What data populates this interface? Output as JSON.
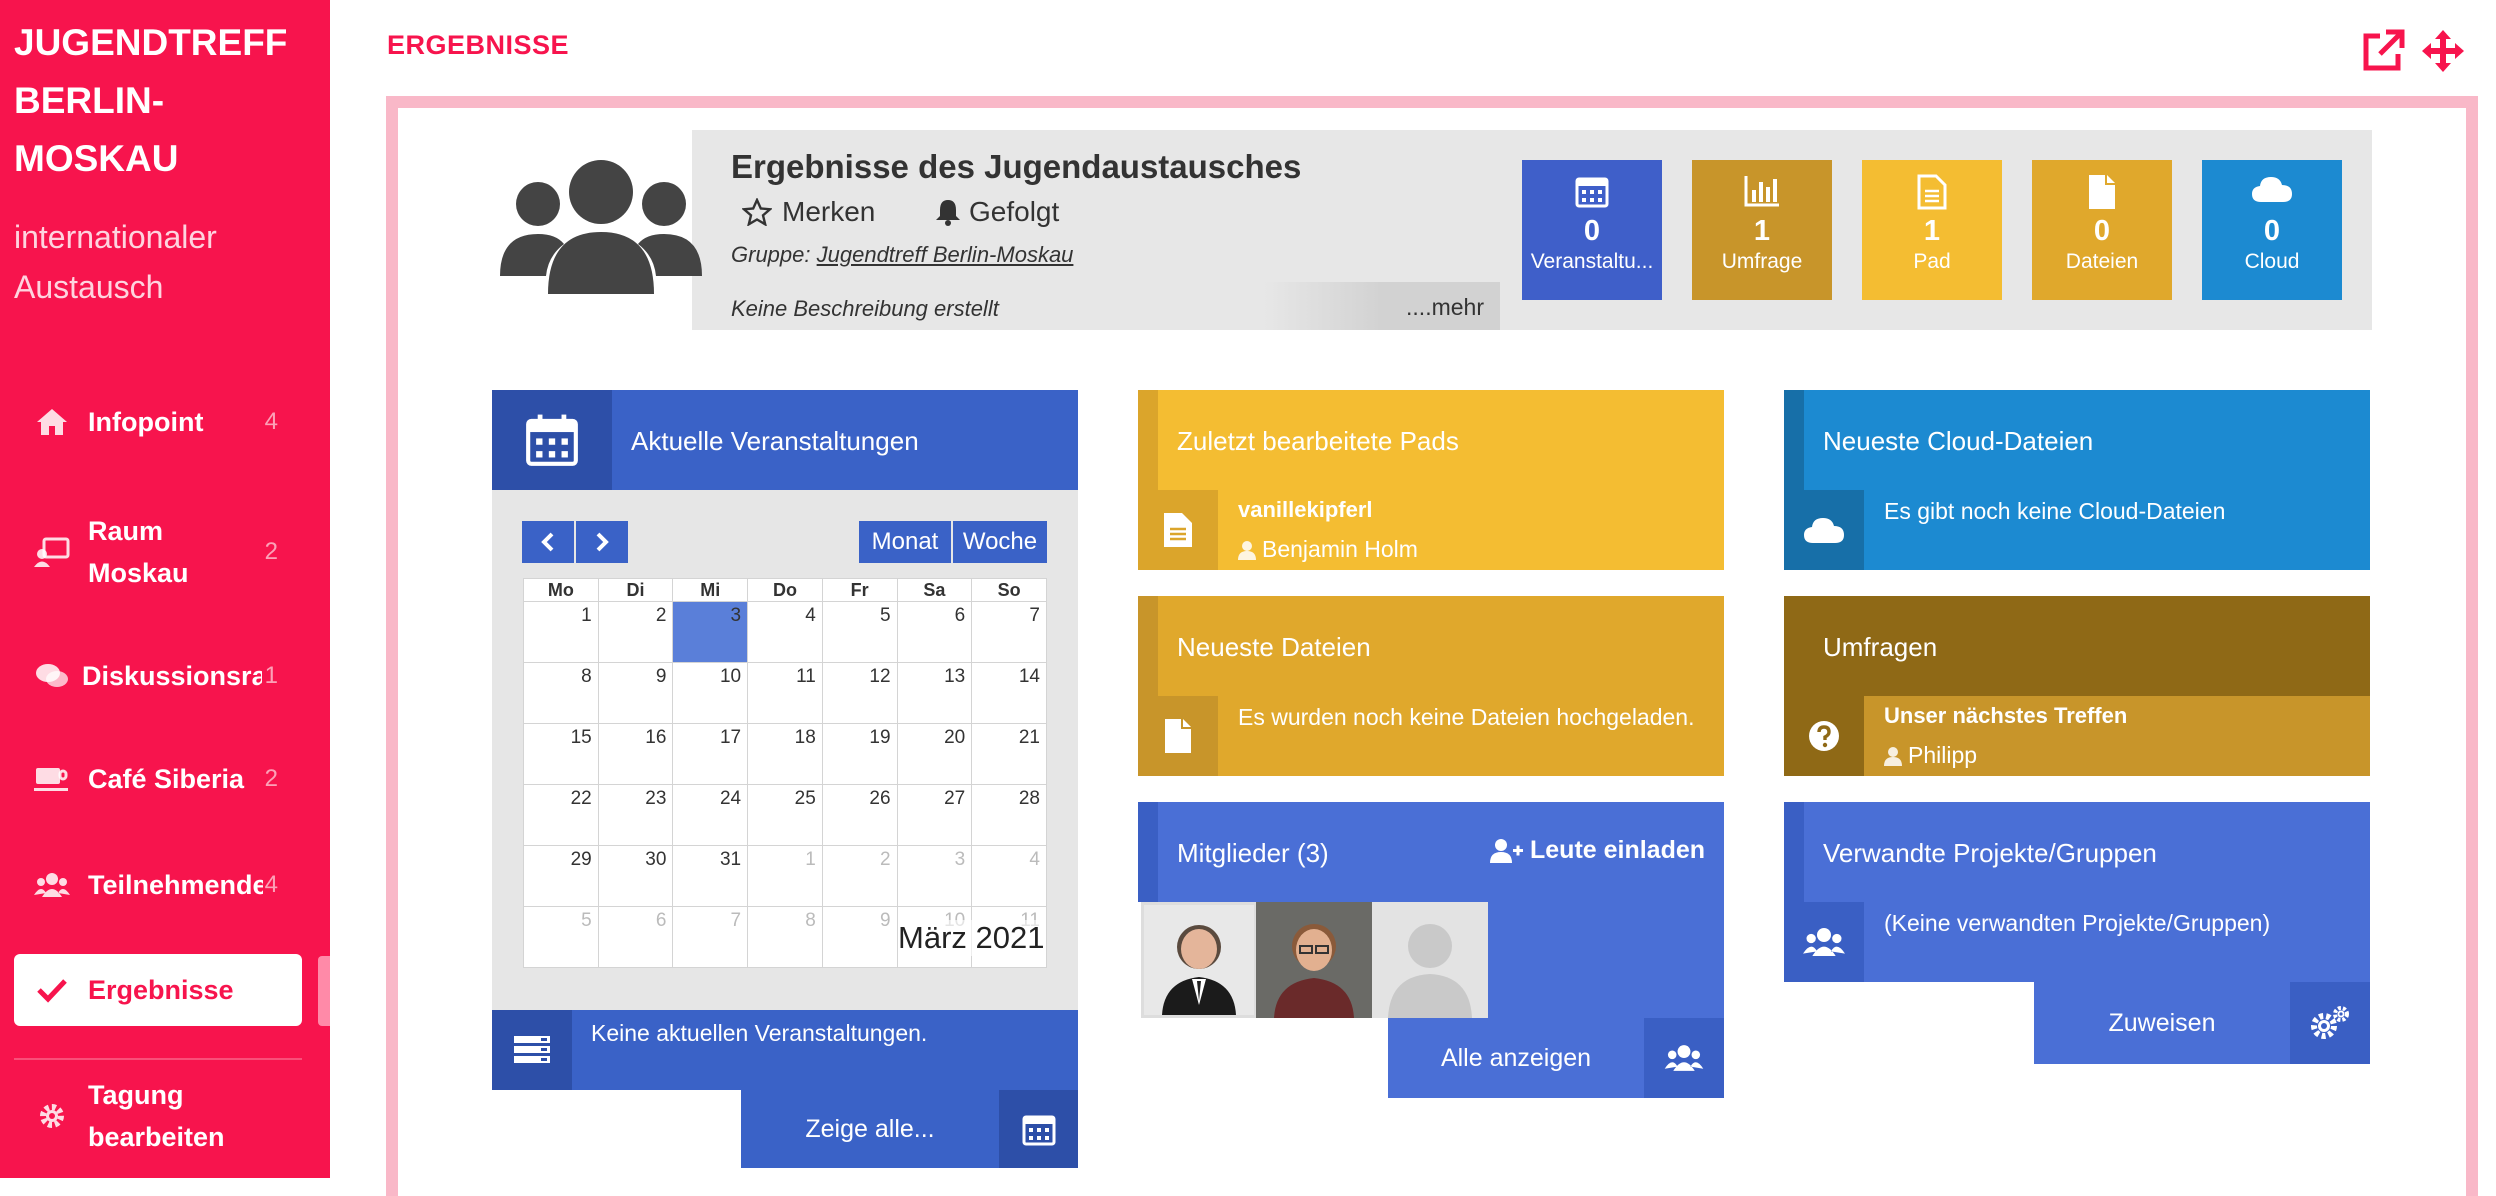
{
  "sidebar": {
    "brand_lines": [
      "JUGENDTREFF",
      "BERLIN-",
      "MOSKAU"
    ],
    "subtitle_lines": [
      "internationaler",
      "Austausch"
    ],
    "items": [
      {
        "label": "Infopoint",
        "count": "4",
        "icon": "home-icon"
      },
      {
        "label_lines": [
          "Raum",
          "Moskau"
        ],
        "count": "2",
        "icon": "room-icon"
      },
      {
        "label": "Diskussionsraum",
        "count": "1",
        "icon": "comments-icon"
      },
      {
        "label": "Café Siberia",
        "count": "2",
        "icon": "coffee-icon"
      },
      {
        "label": "Teilnehmende",
        "count": "4",
        "icon": "users-icon"
      },
      {
        "label": "Ergebnisse",
        "count": "",
        "icon": "check-icon",
        "active": true
      },
      {
        "label_lines": [
          "Tagung",
          "bearbeiten"
        ],
        "count": "",
        "icon": "gear-icon"
      }
    ]
  },
  "page": {
    "title": "ERGEBNISSE"
  },
  "header": {
    "title": "Ergebnisse des Jugendaustausches",
    "merken": "Merken",
    "gefolgt": "Gefolgt",
    "gruppe_label": "Gruppe:",
    "gruppe_link": "Jugendtreff Berlin-Moskau",
    "description": "Keine Beschreibung erstellt",
    "mehr": "....mehr"
  },
  "stats": [
    {
      "value": "0",
      "label": "Veranstaltu...",
      "color": "#3f5fc9",
      "icon": "calendar-icon"
    },
    {
      "value": "1",
      "label": "Umfrage",
      "color": "#c8952a",
      "icon": "poll-icon"
    },
    {
      "value": "1",
      "label": "Pad",
      "color": "#f4bd32",
      "icon": "pad-icon"
    },
    {
      "value": "0",
      "label": "Dateien",
      "color": "#e0a82c",
      "icon": "file-icon"
    },
    {
      "value": "0",
      "label": "Cloud",
      "color": "#1c8ad1",
      "icon": "cloud-icon"
    }
  ],
  "events": {
    "title": "Aktuelle Veranstaltungen",
    "view_month": "Monat",
    "view_week": "Woche",
    "weekdays": [
      "Mo",
      "Di",
      "Mi",
      "Do",
      "Fr",
      "Sa",
      "So"
    ],
    "weeks": [
      [
        "1",
        "2",
        "3",
        "4",
        "5",
        "6",
        "7"
      ],
      [
        "8",
        "9",
        "10",
        "11",
        "12",
        "13",
        "14"
      ],
      [
        "15",
        "16",
        "17",
        "18",
        "19",
        "20",
        "21"
      ],
      [
        "22",
        "23",
        "24",
        "25",
        "26",
        "27",
        "28"
      ],
      [
        "29",
        "30",
        "31",
        "1",
        "2",
        "3",
        "4"
      ],
      [
        "5",
        "6",
        "7",
        "8",
        "9",
        "10",
        "11"
      ]
    ],
    "month_label": "März 2021",
    "empty": "Keine aktuellen Veranstaltungen.",
    "show_all": "Zeige alle..."
  },
  "pads": {
    "title": "Zuletzt bearbeitete Pads",
    "item_title": "vanillekipferl",
    "item_user": "Benjamin Holm"
  },
  "files": {
    "title": "Neueste Dateien",
    "empty": "Es wurden noch keine Dateien hochgeladen."
  },
  "members": {
    "title": "Mitglieder (3)",
    "invite": "Leute einladen",
    "show_all": "Alle anzeigen"
  },
  "cloud": {
    "title": "Neueste Cloud-Dateien",
    "empty": "Es gibt noch keine Cloud-Dateien"
  },
  "polls": {
    "title": "Umfragen",
    "item_title": "Unser nächstes Treffen",
    "item_user": "Philipp"
  },
  "related": {
    "title": "Verwandte Projekte/Gruppen",
    "empty": "(Keine verwandten Projekte/Gruppen)",
    "assign": "Zuweisen"
  }
}
